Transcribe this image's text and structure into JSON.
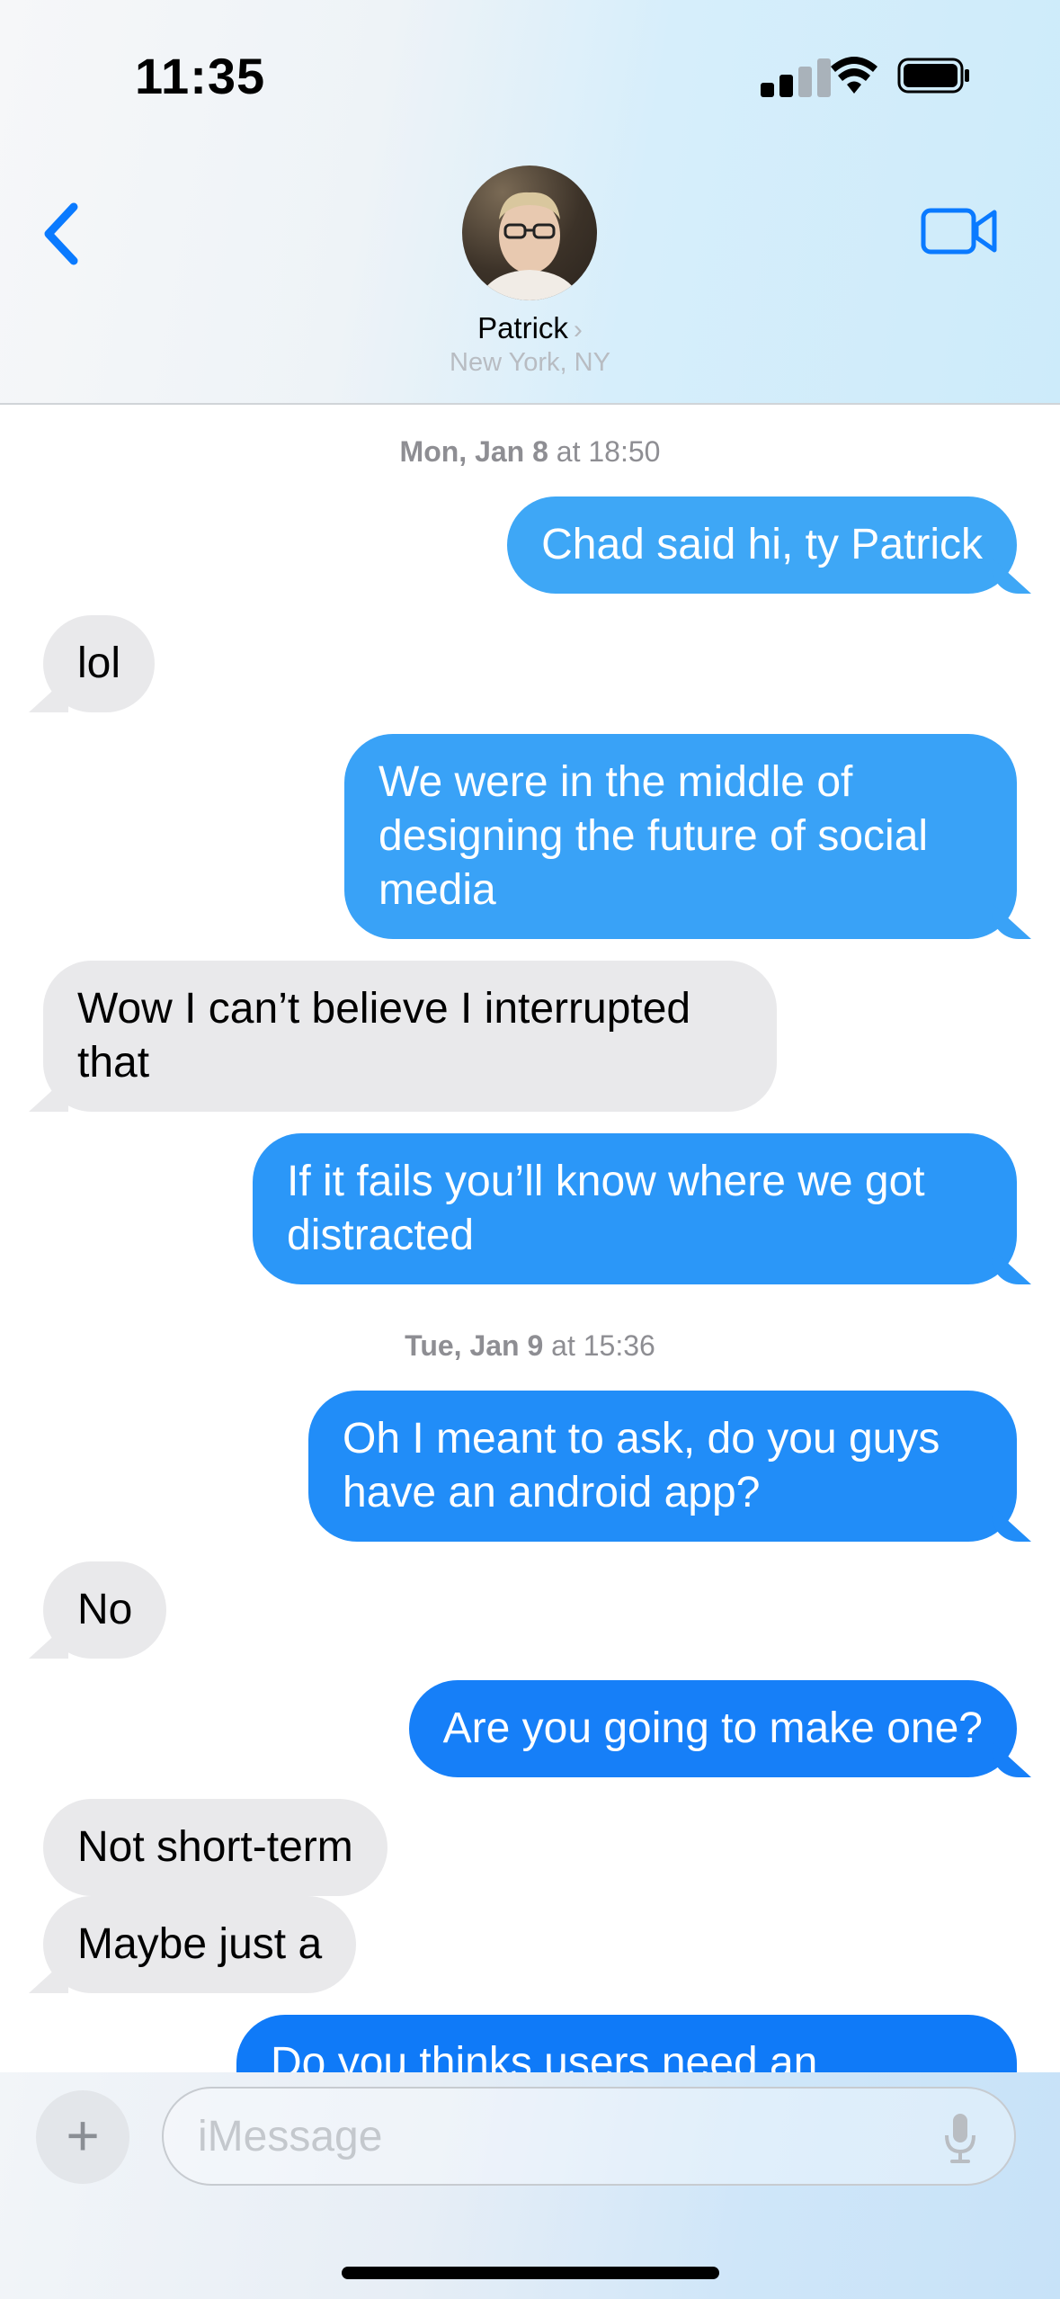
{
  "status_bar": {
    "time": "11:35"
  },
  "header": {
    "contact_name": "Patrick",
    "contact_location": "New York, NY"
  },
  "icons": {
    "back": "chevron-left-icon",
    "video": "video-camera-icon",
    "add": "plus-icon",
    "mic": "microphone-icon"
  },
  "timestamps": [
    {
      "day": "Mon, Jan 8",
      "time": " at 18:50"
    },
    {
      "day": "Tue, Jan 9",
      "time": " at 15:36"
    }
  ],
  "messages": [
    {
      "from": "me",
      "text": "Chad said hi, ty Patrick"
    },
    {
      "from": "them",
      "text": "lol"
    },
    {
      "from": "me",
      "text": "We were in the middle of designing the future of social media"
    },
    {
      "from": "them",
      "text": "Wow I can’t believe I interrupted that"
    },
    {
      "from": "me",
      "text": "If it fails you’ll know where we got distracted"
    },
    {
      "from": "me",
      "text": "Oh I meant to ask, do you guys have an android app?"
    },
    {
      "from": "them",
      "text": "No"
    },
    {
      "from": "me",
      "text": "Are you going to make one?"
    },
    {
      "from": "them",
      "text": "Not short-term"
    },
    {
      "from": "them",
      "text": "Maybe just a"
    },
    {
      "from": "me",
      "text": "Do you thinks users need an"
    }
  ],
  "composer": {
    "placeholder": "iMessage"
  },
  "colors": {
    "outgoing": "#1e8ef6",
    "incoming": "#e9e9eb",
    "accent": "#0a7aff"
  }
}
